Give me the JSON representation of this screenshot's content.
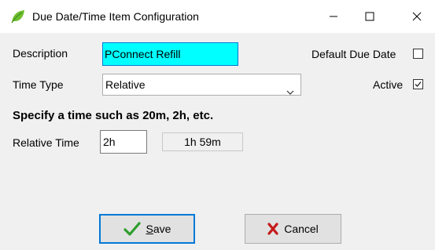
{
  "window": {
    "title": "Due Date/Time Item Configuration",
    "app_icon": "leaf-icon",
    "controls": [
      "minimize-icon",
      "maximize-icon",
      "close-icon"
    ]
  },
  "form": {
    "description_label": "Description",
    "description_value": "PConnect Refill",
    "description_highlight": "#00ffff",
    "default_due_date_label": "Default Due Date",
    "default_due_date_checked": false,
    "time_type_label": "Time Type",
    "time_type_value": "Relative",
    "active_label": "Active",
    "active_checked": true,
    "hint": "Specify a time such as 20m, 2h, etc.",
    "relative_time_label": "Relative Time",
    "relative_time_value": "2h",
    "computed_value": "1h 59m"
  },
  "buttons": {
    "save_label": "Save",
    "save_icon": "checkmark-icon",
    "save_accent": "#0078d7",
    "cancel_label": "Cancel",
    "cancel_icon": "x-icon"
  }
}
